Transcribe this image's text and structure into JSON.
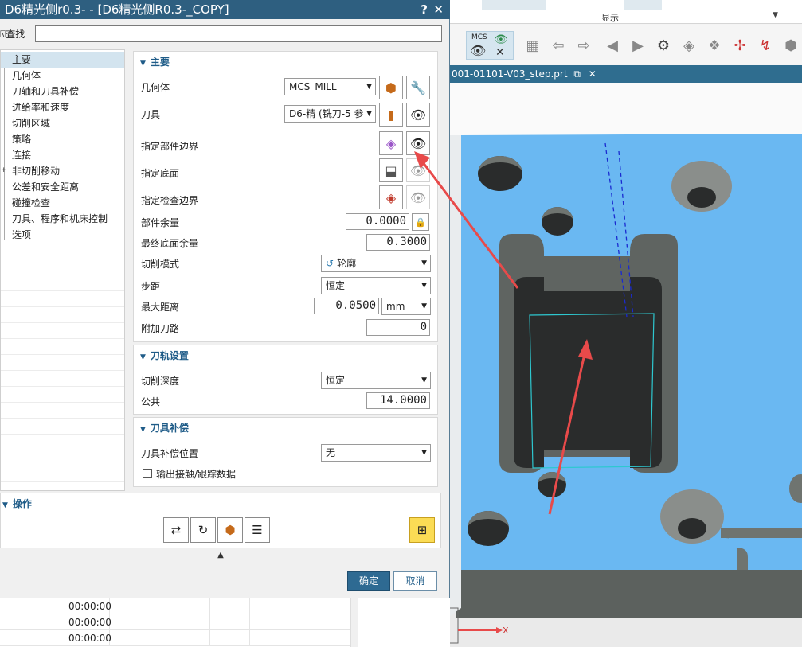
{
  "dialog": {
    "title": "D6精光侧r0.3- - [D6精光侧R0.3-_COPY]",
    "help_glyph": "?",
    "close_glyph": "✕",
    "find_label": "查找",
    "find_value": ""
  },
  "tree": {
    "items": [
      "主要",
      "几何体",
      "刀轴和刀具补偿",
      "进给率和速度",
      "切削区域",
      "策略",
      "连接",
      "非切削移动",
      "公差和安全距离",
      "碰撞检查",
      "刀具、程序和机床控制",
      "选项"
    ],
    "selected": "主要"
  },
  "main_group": {
    "title": "主要",
    "geometry_label": "几何体",
    "geometry_value": "MCS_MILL",
    "tool_label": "刀具",
    "tool_value": "D6-精 (铣刀-5 参",
    "part_boundary_label": "指定部件边界",
    "floor_label": "指定底面",
    "check_boundary_label": "指定检查边界",
    "part_stock_label": "部件余量",
    "part_stock_value": "0.0000",
    "final_floor_stock_label": "最终底面余量",
    "final_floor_stock_value": "0.3000",
    "cut_pattern_label": "切削模式",
    "cut_pattern_value": "轮廓",
    "stepover_label": "步距",
    "stepover_value": "恒定",
    "max_distance_label": "最大距离",
    "max_distance_value": "0.0500",
    "max_distance_unit": "mm",
    "additional_passes_label": "附加刀路",
    "additional_passes_value": "0"
  },
  "path_group": {
    "title": "刀轨设置",
    "cut_depth_label": "切削深度",
    "cut_depth_value": "恒定",
    "common_label": "公共",
    "common_value": "14.0000"
  },
  "comp_group": {
    "title": "刀具补偿",
    "comp_position_label": "刀具补偿位置",
    "comp_position_value": "无",
    "output_contact_label": "输出接触/跟踪数据",
    "output_contact_checked": false
  },
  "operations": {
    "title": "操作"
  },
  "buttons": {
    "ok": "确定",
    "cancel": "取消"
  },
  "background_table": {
    "times": [
      "00:00:00",
      "00:00:00",
      "00:00:00"
    ]
  },
  "cad": {
    "ribbon_label": "显示",
    "mcs_label": "MCS",
    "file_tab": "001-01101-V03_step.prt",
    "tab_close": "✕",
    "axis_x_label": "X",
    "colors": {
      "part_face": "#6ab8f2",
      "wall": "#6f7470",
      "pocket_floor": "#2a2c2c",
      "toolpath": "#2ec8d0",
      "arrow": "#e84a4a"
    }
  }
}
